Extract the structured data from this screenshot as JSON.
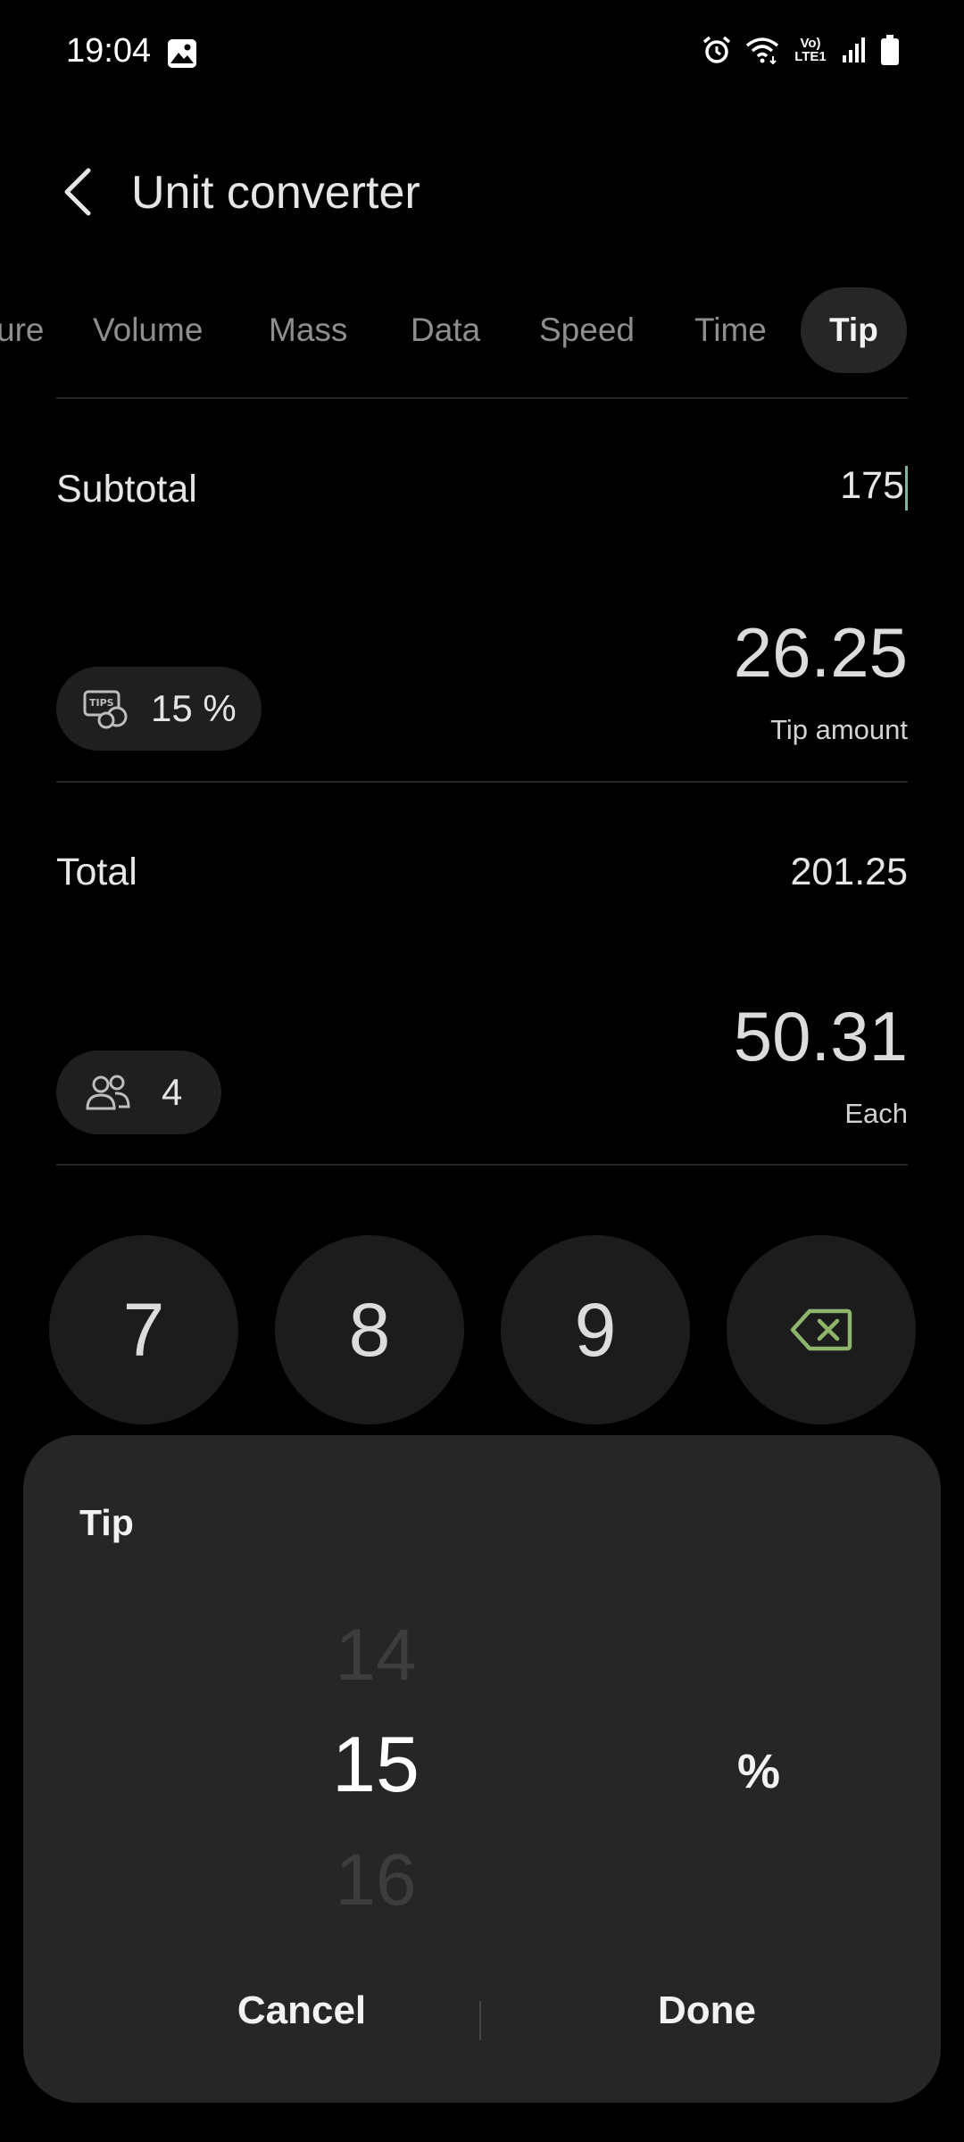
{
  "status_bar": {
    "time": "19:04",
    "network": "Vo) LTE1",
    "icons": [
      "image-icon",
      "alarm-icon",
      "wifi-icon",
      "volte-icon",
      "signal-icon",
      "battery-icon"
    ]
  },
  "header": {
    "title": "Unit converter"
  },
  "tabs": [
    {
      "label": "ure",
      "active": false
    },
    {
      "label": "Volume",
      "active": false
    },
    {
      "label": "Mass",
      "active": false
    },
    {
      "label": "Data",
      "active": false
    },
    {
      "label": "Speed",
      "active": false
    },
    {
      "label": "Time",
      "active": false
    },
    {
      "label": "Tip",
      "active": true
    }
  ],
  "subtotal": {
    "label": "Subtotal",
    "value": "175"
  },
  "tip": {
    "percent_label": "15 %",
    "amount": "26.25",
    "amount_caption": "Tip amount",
    "icon": "tips-icon"
  },
  "total": {
    "label": "Total",
    "value": "201.25"
  },
  "split": {
    "people": "4",
    "each": "50.31",
    "each_caption": "Each",
    "icon": "people-icon"
  },
  "keypad": {
    "keys": [
      "7",
      "8",
      "9"
    ],
    "backspace_icon": "backspace-icon",
    "accent_color": "#8fb56c"
  },
  "tip_dialog": {
    "title": "Tip",
    "picker_prev": "14",
    "picker_current": "15",
    "picker_next": "16",
    "unit": "%",
    "cancel_label": "Cancel",
    "done_label": "Done"
  }
}
